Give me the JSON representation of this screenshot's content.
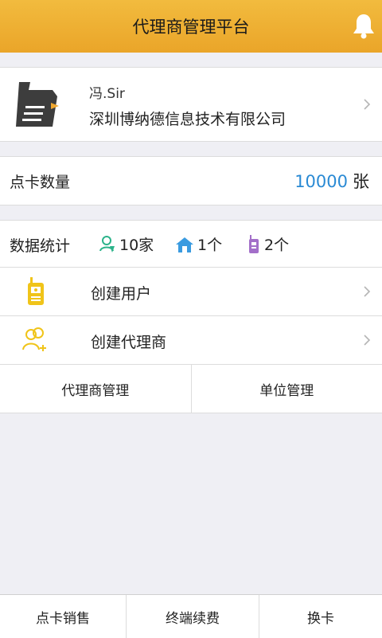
{
  "header": {
    "title": "代理商管理平台"
  },
  "profile": {
    "name": "冯.Sir",
    "company": "深圳博纳德信息技术有限公司"
  },
  "cards": {
    "label": "点卡数量",
    "value": "10000",
    "unit": "张"
  },
  "stats": {
    "label": "数据统计",
    "users": "10家",
    "units": "1个",
    "terminals": "2个"
  },
  "menu": {
    "create_user": "创建用户",
    "create_agent": "创建代理商"
  },
  "tabs": {
    "agent_manage": "代理商管理",
    "unit_manage": "单位管理"
  },
  "bottom_nav": {
    "card_sales": "点卡销售",
    "renewal": "终端续费",
    "swap_card": "换卡"
  },
  "colors": {
    "header": "#eeb034",
    "accent_blue": "#2a8ad4",
    "icon_yellow": "#f0c419"
  }
}
